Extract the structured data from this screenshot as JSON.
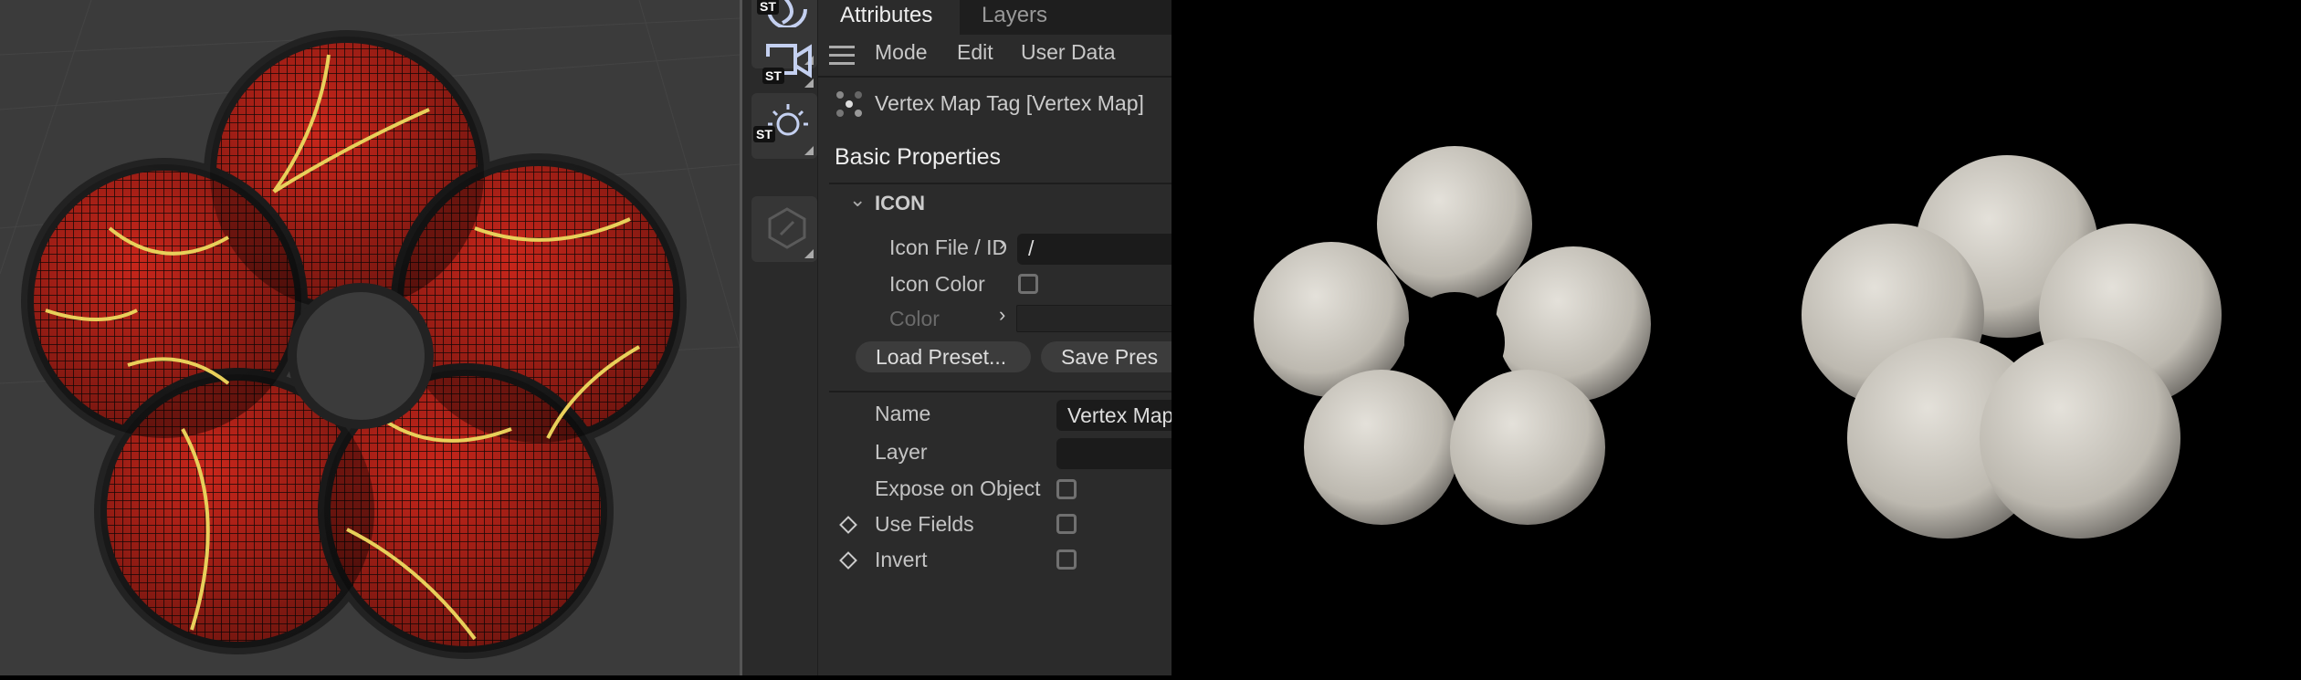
{
  "tabs": [
    {
      "label": "Attributes",
      "active": true
    },
    {
      "label": "Layers",
      "active": false
    }
  ],
  "menu": {
    "mode": "Mode",
    "edit": "Edit",
    "user_data": "User Data"
  },
  "object_title": "Vertex Map Tag [Vertex Map]",
  "section_title": "Basic Properties",
  "group": {
    "label": "ICON",
    "expanded": true
  },
  "icon_fields": {
    "icon_file_label": "Icon File / ID",
    "icon_file_value": "/",
    "icon_color_label": "Icon Color",
    "icon_color_checked": false,
    "color_label": "Color"
  },
  "buttons": {
    "load_preset": "Load Preset...",
    "save_preset": "Save Pres"
  },
  "properties": {
    "name_label": "Name",
    "name_value": "Vertex Map",
    "layer_label": "Layer",
    "layer_value": "",
    "expose_label": "Expose on Object",
    "expose_checked": false,
    "use_fields_label": "Use Fields",
    "use_fields_checked": false,
    "invert_label": "Invert",
    "invert_checked": false
  },
  "toolbar": {
    "badge": "ST",
    "icons": [
      "sphere-tool-icon",
      "camera-tool-icon",
      "light-tool-icon",
      "edit-hexagon-icon"
    ]
  },
  "colors": {
    "mesh": "#c8261b",
    "seams": "#e8d05a",
    "render_clay": "#cfcbc2",
    "panel_bg": "#2b2b2b"
  }
}
